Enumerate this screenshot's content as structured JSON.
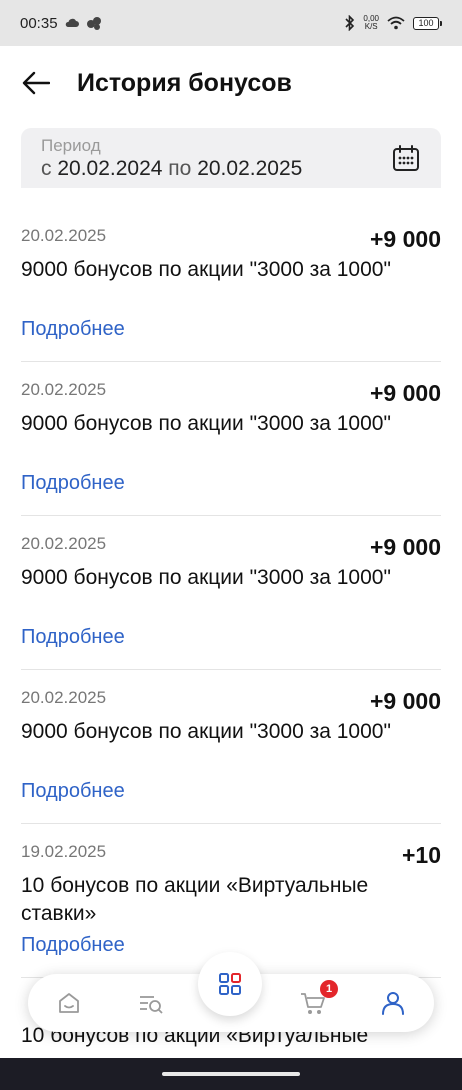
{
  "status_bar": {
    "time": "00:35",
    "net_speed_value": "0,00",
    "net_speed_unit": "K/S",
    "battery": "100"
  },
  "header": {
    "title": "История бонусов"
  },
  "period": {
    "label": "Период",
    "from_prefix": "с",
    "from_date": "20.02.2024",
    "to_prefix": "по",
    "to_date": "20.02.2025"
  },
  "history": [
    {
      "date": "20.02.2025",
      "amount": "+9 000",
      "description": "9000 бонусов по акции \"3000 за 1000\"",
      "more_label": "Подробнее"
    },
    {
      "date": "20.02.2025",
      "amount": "+9 000",
      "description": "9000 бонусов по акции \"3000 за 1000\"",
      "more_label": "Подробнее"
    },
    {
      "date": "20.02.2025",
      "amount": "+9 000",
      "description": "9000 бонусов по акции \"3000 за 1000\"",
      "more_label": "Подробнее"
    },
    {
      "date": "20.02.2025",
      "amount": "+9 000",
      "description": "9000 бонусов по акции \"3000 за 1000\"",
      "more_label": "Подробнее"
    },
    {
      "date": "19.02.2025",
      "amount": "+10",
      "description": "10 бонусов по акции «Виртуальные ставки»",
      "more_label": "Подробнее"
    }
  ],
  "partial_next_item": "10 бонусов по акции «Виртуальные",
  "bottom_nav": {
    "cart_badge": "1",
    "accent_color": "#2f63c7",
    "icons": [
      "home-icon",
      "search-list-icon",
      "catalog-grid-icon",
      "cart-icon",
      "profile-icon"
    ]
  }
}
